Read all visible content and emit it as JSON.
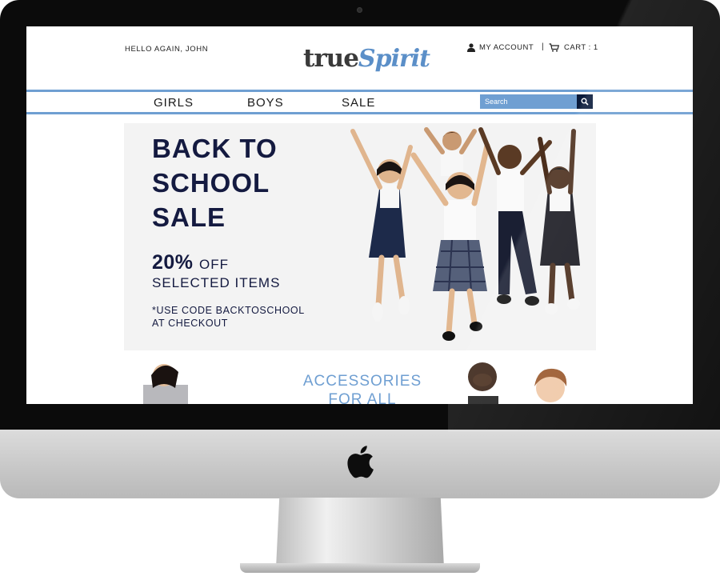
{
  "header": {
    "greeting": "HELLO AGAIN, JOHN",
    "logo_part1": "true",
    "logo_part2": "Spirit",
    "account_label": "MY ACCOUNT",
    "divider": "|",
    "cart_label": "CART : 1"
  },
  "nav": {
    "items": [
      {
        "label": "GIRLS"
      },
      {
        "label": "BOYS"
      },
      {
        "label": "SALE"
      }
    ],
    "search_placeholder": "Search"
  },
  "hero": {
    "title": "BACK TO\nSCHOOL\nSALE",
    "discount_value": "20%",
    "discount_off": "OFF",
    "selected_items": "SELECTED ITEMS",
    "code_note": "*USE CODE BACKTOSCHOOL\nAT CHECKOUT"
  },
  "accessories": {
    "title": "ACCESSORIES\nFOR ALL"
  },
  "colors": {
    "accent": "#6f9fd2",
    "navy": "#141a40",
    "search_button": "#0a1a3a"
  },
  "icons": {
    "account": "user-icon",
    "cart": "cart-icon",
    "search": "magnifier-icon",
    "apple": "apple-logo-icon"
  }
}
